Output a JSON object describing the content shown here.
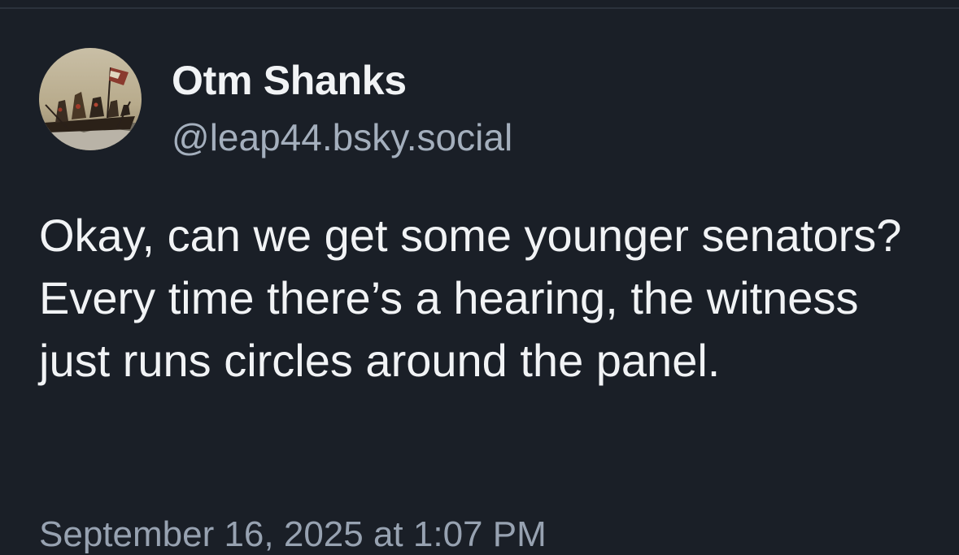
{
  "post": {
    "author": {
      "display_name": "Otm Shanks",
      "handle": "@leap44.bsky.social",
      "avatar_icon": "painting-avatar-icon"
    },
    "text": "Okay, can we get some younger senators? Every time there’s a hearing, the witness just runs circles around the panel.",
    "timestamp": "September 16, 2025 at 1:07 PM"
  },
  "colors": {
    "background": "#1a1f27",
    "text_primary": "#f1f3f5",
    "text_secondary": "#a4afbd",
    "divider": "#2b323c"
  }
}
